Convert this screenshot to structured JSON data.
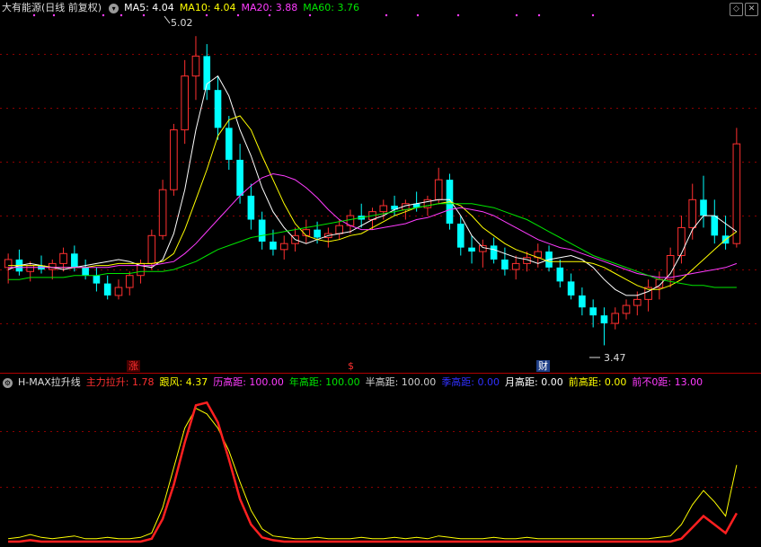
{
  "main_header": {
    "title": "大有能源(日线 前复权)",
    "ma": [
      {
        "label": "MA5: 4.04",
        "color": "#ffffff"
      },
      {
        "label": "MA10: 4.04",
        "color": "#ffff00"
      },
      {
        "label": "MA20: 3.88",
        "color": "#ff3cff"
      },
      {
        "label": "MA60: 3.76",
        "color": "#00e600"
      }
    ]
  },
  "indicator_header": {
    "name": "H-MAX拉升线",
    "items": [
      {
        "label": "主力拉升: 1.78",
        "color": "#ff3030"
      },
      {
        "label": "跟风: 4.37",
        "color": "#ffff00"
      },
      {
        "label": "历高距: 100.00",
        "color": "#ff3cff"
      },
      {
        "label": "年高距: 100.00",
        "color": "#00e600"
      },
      {
        "label": "半高距: 100.00",
        "color": "#d0d0d0"
      },
      {
        "label": "季高距: 0.00",
        "color": "#3030ff"
      },
      {
        "label": "月高距: 0.00",
        "color": "#ffffff"
      },
      {
        "label": "前高距: 0.00",
        "color": "#ffff00"
      },
      {
        "label": "前不0距: 13.00",
        "color": "#ff3cff"
      }
    ]
  },
  "markers": [
    {
      "text": "涨",
      "color": "#ff3030",
      "bg": "#4a0000"
    },
    {
      "text": "$",
      "color": "#ff3030",
      "bg": ""
    },
    {
      "text": "财",
      "color": "#ffffff",
      "bg": "#1f3f88"
    }
  ],
  "annotations": {
    "high": "5.02",
    "low": "3.47"
  },
  "controls": {
    "settings_icon": "gear-icon",
    "diamond_icon": "diamond-icon",
    "close_icon": "close-icon"
  },
  "colors": {
    "up": "#ff3030",
    "down": "#00ffff",
    "grid": "#8b0000",
    "ma5": "#ffffff",
    "ma10": "#ffff00",
    "ma20": "#ff3cff",
    "ma60": "#00e600"
  },
  "chart_data": [
    {
      "type": "candlestick",
      "title": "大有能源(日线 前复权)",
      "series": [
        {
          "name": "MA5",
          "values": [
            3.85,
            3.87,
            3.88,
            3.87,
            3.86,
            3.85,
            3.86,
            3.87,
            3.88,
            3.89,
            3.9,
            3.89,
            3.87,
            3.86,
            3.9,
            4.03,
            4.25,
            4.55,
            4.78,
            4.82,
            4.72,
            4.55,
            4.42,
            4.26,
            4.14,
            4.06,
            4.0,
            3.98,
            4.0,
            4.02,
            4.03,
            4.04,
            4.07,
            4.1,
            4.12,
            4.15,
            4.17,
            4.18,
            4.19,
            4.2,
            4.2,
            4.12,
            4.02,
            3.96,
            3.95,
            3.93,
            3.91,
            3.9,
            3.88,
            3.9,
            3.91,
            3.92,
            3.9,
            3.86,
            3.8,
            3.75,
            3.72,
            3.72,
            3.74,
            3.77,
            3.83,
            3.93,
            4.05,
            4.12,
            4.12,
            4.08,
            4.04
          ]
        },
        {
          "name": "MA10",
          "values": [
            3.87,
            3.87,
            3.87,
            3.87,
            3.86,
            3.86,
            3.86,
            3.86,
            3.87,
            3.87,
            3.88,
            3.88,
            3.88,
            3.88,
            3.89,
            3.93,
            4.05,
            4.2,
            4.35,
            4.52,
            4.6,
            4.62,
            4.55,
            4.42,
            4.3,
            4.18,
            4.08,
            4.02,
            4.0,
            3.99,
            4.0,
            4.02,
            4.03,
            4.06,
            4.09,
            4.12,
            4.14,
            4.16,
            4.17,
            4.18,
            4.19,
            4.17,
            4.12,
            4.06,
            4.02,
            3.98,
            3.95,
            3.93,
            3.91,
            3.89,
            3.89,
            3.89,
            3.89,
            3.88,
            3.86,
            3.83,
            3.8,
            3.77,
            3.75,
            3.75,
            3.77,
            3.8,
            3.85,
            3.9,
            3.95,
            4.0,
            4.04
          ]
        },
        {
          "name": "MA20",
          "values": [
            3.86,
            3.86,
            3.86,
            3.86,
            3.86,
            3.86,
            3.86,
            3.86,
            3.86,
            3.86,
            3.87,
            3.87,
            3.87,
            3.87,
            3.88,
            3.89,
            3.93,
            3.98,
            4.04,
            4.1,
            4.16,
            4.22,
            4.27,
            4.31,
            4.33,
            4.32,
            4.3,
            4.26,
            4.21,
            4.15,
            4.1,
            4.07,
            4.05,
            4.05,
            4.06,
            4.07,
            4.08,
            4.1,
            4.11,
            4.13,
            4.15,
            4.16,
            4.15,
            4.14,
            4.12,
            4.09,
            4.06,
            4.03,
            4.0,
            3.98,
            3.96,
            3.95,
            3.93,
            3.91,
            3.89,
            3.87,
            3.85,
            3.83,
            3.82,
            3.81,
            3.81,
            3.82,
            3.83,
            3.84,
            3.85,
            3.86,
            3.88
          ]
        },
        {
          "name": "MA60",
          "values": [
            3.8,
            3.8,
            3.81,
            3.81,
            3.81,
            3.81,
            3.82,
            3.82,
            3.82,
            3.83,
            3.83,
            3.83,
            3.84,
            3.84,
            3.84,
            3.85,
            3.87,
            3.89,
            3.92,
            3.95,
            3.97,
            3.99,
            4.01,
            4.02,
            4.03,
            4.04,
            4.05,
            4.06,
            4.07,
            4.08,
            4.09,
            4.1,
            4.11,
            4.12,
            4.13,
            4.14,
            4.15,
            4.16,
            4.17,
            4.18,
            4.18,
            4.18,
            4.18,
            4.17,
            4.16,
            4.14,
            4.12,
            4.1,
            4.07,
            4.04,
            4.01,
            3.98,
            3.95,
            3.92,
            3.9,
            3.88,
            3.86,
            3.84,
            3.82,
            3.8,
            3.79,
            3.78,
            3.77,
            3.77,
            3.76,
            3.76,
            3.76
          ]
        }
      ],
      "candles": [
        {
          "o": 3.86,
          "h": 3.93,
          "l": 3.78,
          "c": 3.9
        },
        {
          "o": 3.9,
          "h": 3.95,
          "l": 3.82,
          "c": 3.84
        },
        {
          "o": 3.84,
          "h": 3.89,
          "l": 3.79,
          "c": 3.87
        },
        {
          "o": 3.87,
          "h": 3.92,
          "l": 3.83,
          "c": 3.85
        },
        {
          "o": 3.85,
          "h": 3.9,
          "l": 3.8,
          "c": 3.88
        },
        {
          "o": 3.88,
          "h": 3.96,
          "l": 3.84,
          "c": 3.93
        },
        {
          "o": 3.93,
          "h": 3.97,
          "l": 3.84,
          "c": 3.86
        },
        {
          "o": 3.86,
          "h": 3.9,
          "l": 3.8,
          "c": 3.82
        },
        {
          "o": 3.82,
          "h": 3.86,
          "l": 3.74,
          "c": 3.78
        },
        {
          "o": 3.78,
          "h": 3.82,
          "l": 3.7,
          "c": 3.72
        },
        {
          "o": 3.72,
          "h": 3.8,
          "l": 3.7,
          "c": 3.76
        },
        {
          "o": 3.76,
          "h": 3.84,
          "l": 3.72,
          "c": 3.82
        },
        {
          "o": 3.82,
          "h": 3.9,
          "l": 3.78,
          "c": 3.88
        },
        {
          "o": 3.88,
          "h": 4.05,
          "l": 3.85,
          "c": 4.02
        },
        {
          "o": 4.02,
          "h": 4.3,
          "l": 4.0,
          "c": 4.25
        },
        {
          "o": 4.25,
          "h": 4.58,
          "l": 4.22,
          "c": 4.55
        },
        {
          "o": 4.55,
          "h": 4.9,
          "l": 4.48,
          "c": 4.82
        },
        {
          "o": 4.82,
          "h": 5.02,
          "l": 4.7,
          "c": 4.92
        },
        {
          "o": 4.92,
          "h": 4.98,
          "l": 4.7,
          "c": 4.75
        },
        {
          "o": 4.75,
          "h": 4.82,
          "l": 4.5,
          "c": 4.56
        },
        {
          "o": 4.56,
          "h": 4.62,
          "l": 4.35,
          "c": 4.4
        },
        {
          "o": 4.4,
          "h": 4.48,
          "l": 4.18,
          "c": 4.22
        },
        {
          "o": 4.22,
          "h": 4.28,
          "l": 4.05,
          "c": 4.1
        },
        {
          "o": 4.1,
          "h": 4.14,
          "l": 3.95,
          "c": 3.99
        },
        {
          "o": 3.99,
          "h": 4.05,
          "l": 3.92,
          "c": 3.95
        },
        {
          "o": 3.95,
          "h": 4.02,
          "l": 3.9,
          "c": 3.98
        },
        {
          "o": 3.98,
          "h": 4.06,
          "l": 3.94,
          "c": 4.02
        },
        {
          "o": 4.02,
          "h": 4.1,
          "l": 3.98,
          "c": 4.05
        },
        {
          "o": 4.05,
          "h": 4.09,
          "l": 3.98,
          "c": 4.01
        },
        {
          "o": 4.01,
          "h": 4.06,
          "l": 3.96,
          "c": 4.03
        },
        {
          "o": 4.03,
          "h": 4.1,
          "l": 4.0,
          "c": 4.07
        },
        {
          "o": 4.07,
          "h": 4.15,
          "l": 4.03,
          "c": 4.12
        },
        {
          "o": 4.12,
          "h": 4.18,
          "l": 4.06,
          "c": 4.1
        },
        {
          "o": 4.1,
          "h": 4.16,
          "l": 4.05,
          "c": 4.14
        },
        {
          "o": 4.14,
          "h": 4.2,
          "l": 4.1,
          "c": 4.17
        },
        {
          "o": 4.17,
          "h": 4.22,
          "l": 4.12,
          "c": 4.15
        },
        {
          "o": 4.15,
          "h": 4.2,
          "l": 4.1,
          "c": 4.18
        },
        {
          "o": 4.18,
          "h": 4.24,
          "l": 4.14,
          "c": 4.16
        },
        {
          "o": 4.16,
          "h": 4.22,
          "l": 4.12,
          "c": 4.2
        },
        {
          "o": 4.2,
          "h": 4.36,
          "l": 4.18,
          "c": 4.3
        },
        {
          "o": 4.3,
          "h": 4.33,
          "l": 4.05,
          "c": 4.08
        },
        {
          "o": 4.08,
          "h": 4.12,
          "l": 3.92,
          "c": 3.96
        },
        {
          "o": 3.96,
          "h": 4.02,
          "l": 3.88,
          "c": 3.94
        },
        {
          "o": 3.94,
          "h": 4.0,
          "l": 3.86,
          "c": 3.97
        },
        {
          "o": 3.97,
          "h": 4.01,
          "l": 3.88,
          "c": 3.9
        },
        {
          "o": 3.9,
          "h": 3.96,
          "l": 3.82,
          "c": 3.85
        },
        {
          "o": 3.85,
          "h": 3.92,
          "l": 3.8,
          "c": 3.88
        },
        {
          "o": 3.88,
          "h": 3.94,
          "l": 3.84,
          "c": 3.91
        },
        {
          "o": 3.91,
          "h": 3.98,
          "l": 3.86,
          "c": 3.94
        },
        {
          "o": 3.94,
          "h": 3.97,
          "l": 3.84,
          "c": 3.86
        },
        {
          "o": 3.86,
          "h": 3.9,
          "l": 3.76,
          "c": 3.79
        },
        {
          "o": 3.79,
          "h": 3.83,
          "l": 3.7,
          "c": 3.72
        },
        {
          "o": 3.72,
          "h": 3.76,
          "l": 3.62,
          "c": 3.66
        },
        {
          "o": 3.66,
          "h": 3.7,
          "l": 3.56,
          "c": 3.62
        },
        {
          "o": 3.62,
          "h": 3.66,
          "l": 3.47,
          "c": 3.58
        },
        {
          "o": 3.58,
          "h": 3.66,
          "l": 3.55,
          "c": 3.63
        },
        {
          "o": 3.63,
          "h": 3.7,
          "l": 3.6,
          "c": 3.67
        },
        {
          "o": 3.67,
          "h": 3.74,
          "l": 3.62,
          "c": 3.7
        },
        {
          "o": 3.7,
          "h": 3.8,
          "l": 3.64,
          "c": 3.76
        },
        {
          "o": 3.76,
          "h": 3.84,
          "l": 3.7,
          "c": 3.8
        },
        {
          "o": 3.8,
          "h": 3.96,
          "l": 3.76,
          "c": 3.92
        },
        {
          "o": 3.92,
          "h": 4.12,
          "l": 3.88,
          "c": 4.06
        },
        {
          "o": 4.06,
          "h": 4.28,
          "l": 4.0,
          "c": 4.2
        },
        {
          "o": 4.2,
          "h": 4.32,
          "l": 4.06,
          "c": 4.12
        },
        {
          "o": 4.12,
          "h": 4.2,
          "l": 3.98,
          "c": 4.02
        },
        {
          "o": 4.02,
          "h": 4.12,
          "l": 3.95,
          "c": 3.98
        },
        {
          "o": 3.98,
          "h": 4.56,
          "l": 3.96,
          "c": 4.48
        }
      ],
      "ylim": [
        3.4,
        5.12
      ]
    },
    {
      "type": "line",
      "title": "H-MAX拉升线",
      "series": [
        {
          "name": "主力拉升",
          "values": [
            0,
            0,
            1,
            0,
            0,
            0,
            0,
            0,
            0,
            0,
            0,
            0,
            0,
            2,
            16,
            40,
            70,
            96,
            98,
            84,
            58,
            30,
            12,
            3,
            1,
            0,
            0,
            0,
            0,
            0,
            0,
            0,
            0,
            0,
            0,
            0,
            0,
            0,
            0,
            0,
            0,
            0,
            0,
            0,
            0,
            0,
            0,
            0,
            0,
            0,
            0,
            0,
            0,
            0,
            0,
            0,
            0,
            0,
            0,
            0,
            0,
            2,
            10,
            18,
            12,
            6,
            20
          ]
        },
        {
          "name": "跟风",
          "values": [
            2,
            3,
            5,
            3,
            2,
            3,
            4,
            2,
            2,
            3,
            2,
            2,
            3,
            6,
            24,
            52,
            80,
            94,
            90,
            80,
            64,
            42,
            22,
            9,
            4,
            3,
            2,
            2,
            3,
            2,
            2,
            2,
            3,
            2,
            2,
            3,
            2,
            3,
            2,
            4,
            3,
            2,
            2,
            2,
            3,
            2,
            2,
            3,
            2,
            2,
            2,
            2,
            2,
            2,
            2,
            2,
            2,
            2,
            2,
            3,
            4,
            12,
            26,
            36,
            28,
            18,
            54
          ]
        }
      ],
      "ylim": [
        0,
        100
      ]
    }
  ]
}
